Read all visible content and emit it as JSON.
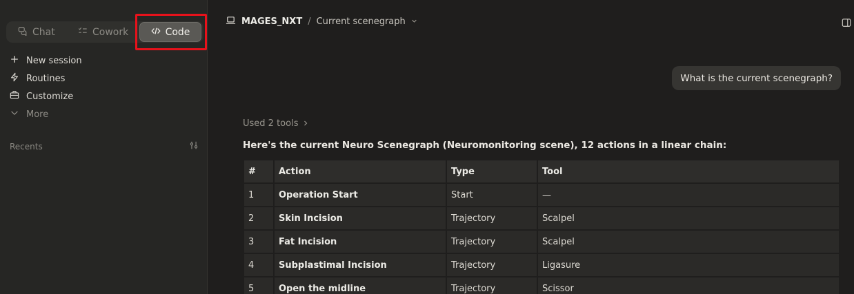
{
  "sidebar": {
    "modes": {
      "chat": "Chat",
      "cowork": "Cowork",
      "code": "Code"
    },
    "nav": {
      "new_session": "New session",
      "routines": "Routines",
      "customize": "Customize",
      "more": "More"
    },
    "recents_label": "Recents"
  },
  "topbar": {
    "project": "MAGES_NXT",
    "separator": "/",
    "crumb": "Current scenegraph"
  },
  "conversation": {
    "user_message": "What is the current scenegraph?",
    "tools_used": "Used 2 tools",
    "intro": "Here's the current Neuro Scenegraph (Neuromonitoring scene), 12 actions in a linear chain:"
  },
  "table": {
    "headers": [
      "#",
      "Action",
      "Type",
      "Tool"
    ],
    "rows": [
      [
        "1",
        "Operation Start",
        "Start",
        "—"
      ],
      [
        "2",
        "Skin Incision",
        "Trajectory",
        "Scalpel"
      ],
      [
        "3",
        "Fat Incision",
        "Trajectory",
        "Scalpel"
      ],
      [
        "4",
        "Subplastimal Incision",
        "Trajectory",
        "Ligasure"
      ],
      [
        "5",
        "Open the midline",
        "Trajectory",
        "Scissor"
      ]
    ]
  },
  "colors": {
    "background": "#1f1e1d",
    "sidebar": "#262624",
    "highlight": "#e8121b"
  }
}
